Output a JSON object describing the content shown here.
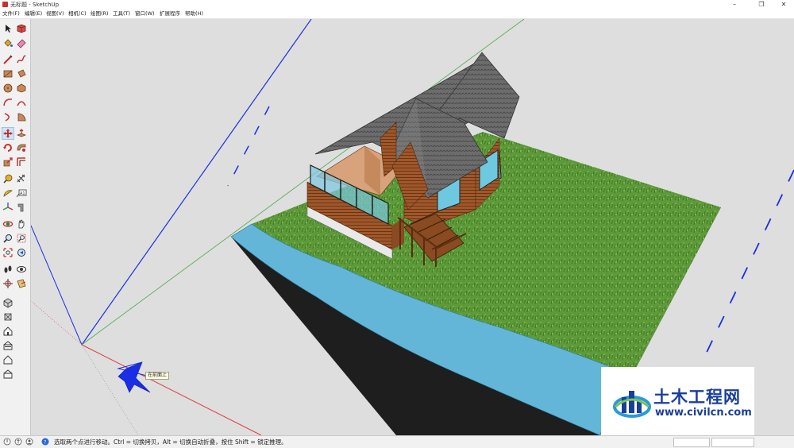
{
  "window": {
    "title": "无标题 - SketchUp",
    "minimize": "–",
    "restore": "❐",
    "close": "✕"
  },
  "menu": {
    "items": [
      "文件(F)",
      "编辑(E)",
      "视图(V)",
      "相机(C)",
      "绘图(R)",
      "工具(T)",
      "窗口(W)",
      "扩展程序",
      "帮助(H)"
    ]
  },
  "toolbar": {
    "tools": [
      "select-icon",
      "make-component-icon",
      "paint-bucket-icon",
      "eraser-icon",
      "line-icon",
      "freehand-icon",
      "rectangle-icon",
      "rotated-rectangle-icon",
      "circle-icon",
      "polygon-icon",
      "arc-icon",
      "two-point-arc-icon",
      "three-point-arc-icon",
      "pie-icon",
      "move-icon",
      "push-pull-icon",
      "rotate-icon",
      "follow-me-icon",
      "scale-icon",
      "offset-icon",
      "tape-measure-icon",
      "dimension-icon",
      "protractor-icon",
      "text-icon",
      "axes-icon",
      "3d-text-icon",
      "orbit-icon",
      "pan-icon",
      "zoom-icon",
      "zoom-window-icon",
      "zoom-extents-icon",
      "previous-view-icon",
      "walk-icon",
      "look-around-icon",
      "position-camera-icon",
      "section-plane-icon",
      "iso-view-icon",
      "top-view-icon",
      "front-view-icon",
      "right-view-icon",
      "back-view-icon",
      "left-view-icon"
    ],
    "active_tool": "move-icon"
  },
  "viewport": {
    "tooltip": "在前面上",
    "colors": {
      "background": "#dedede",
      "axis_blue": "#1a2ee6",
      "axis_red": "#e03a3a",
      "axis_green": "#4aa84a",
      "grass": "#5e9a3a",
      "water": "#63b6d8",
      "roof": "#6c6c6c",
      "wood": "#a0582a"
    }
  },
  "watermark": {
    "title": "土木工程网",
    "url": "www.civilcn.com"
  },
  "status": {
    "message": "选取两个点进行移动。Ctrl = 切换拷贝，Alt = 切换自动折叠，按住 Shift = 锁定推理。"
  }
}
